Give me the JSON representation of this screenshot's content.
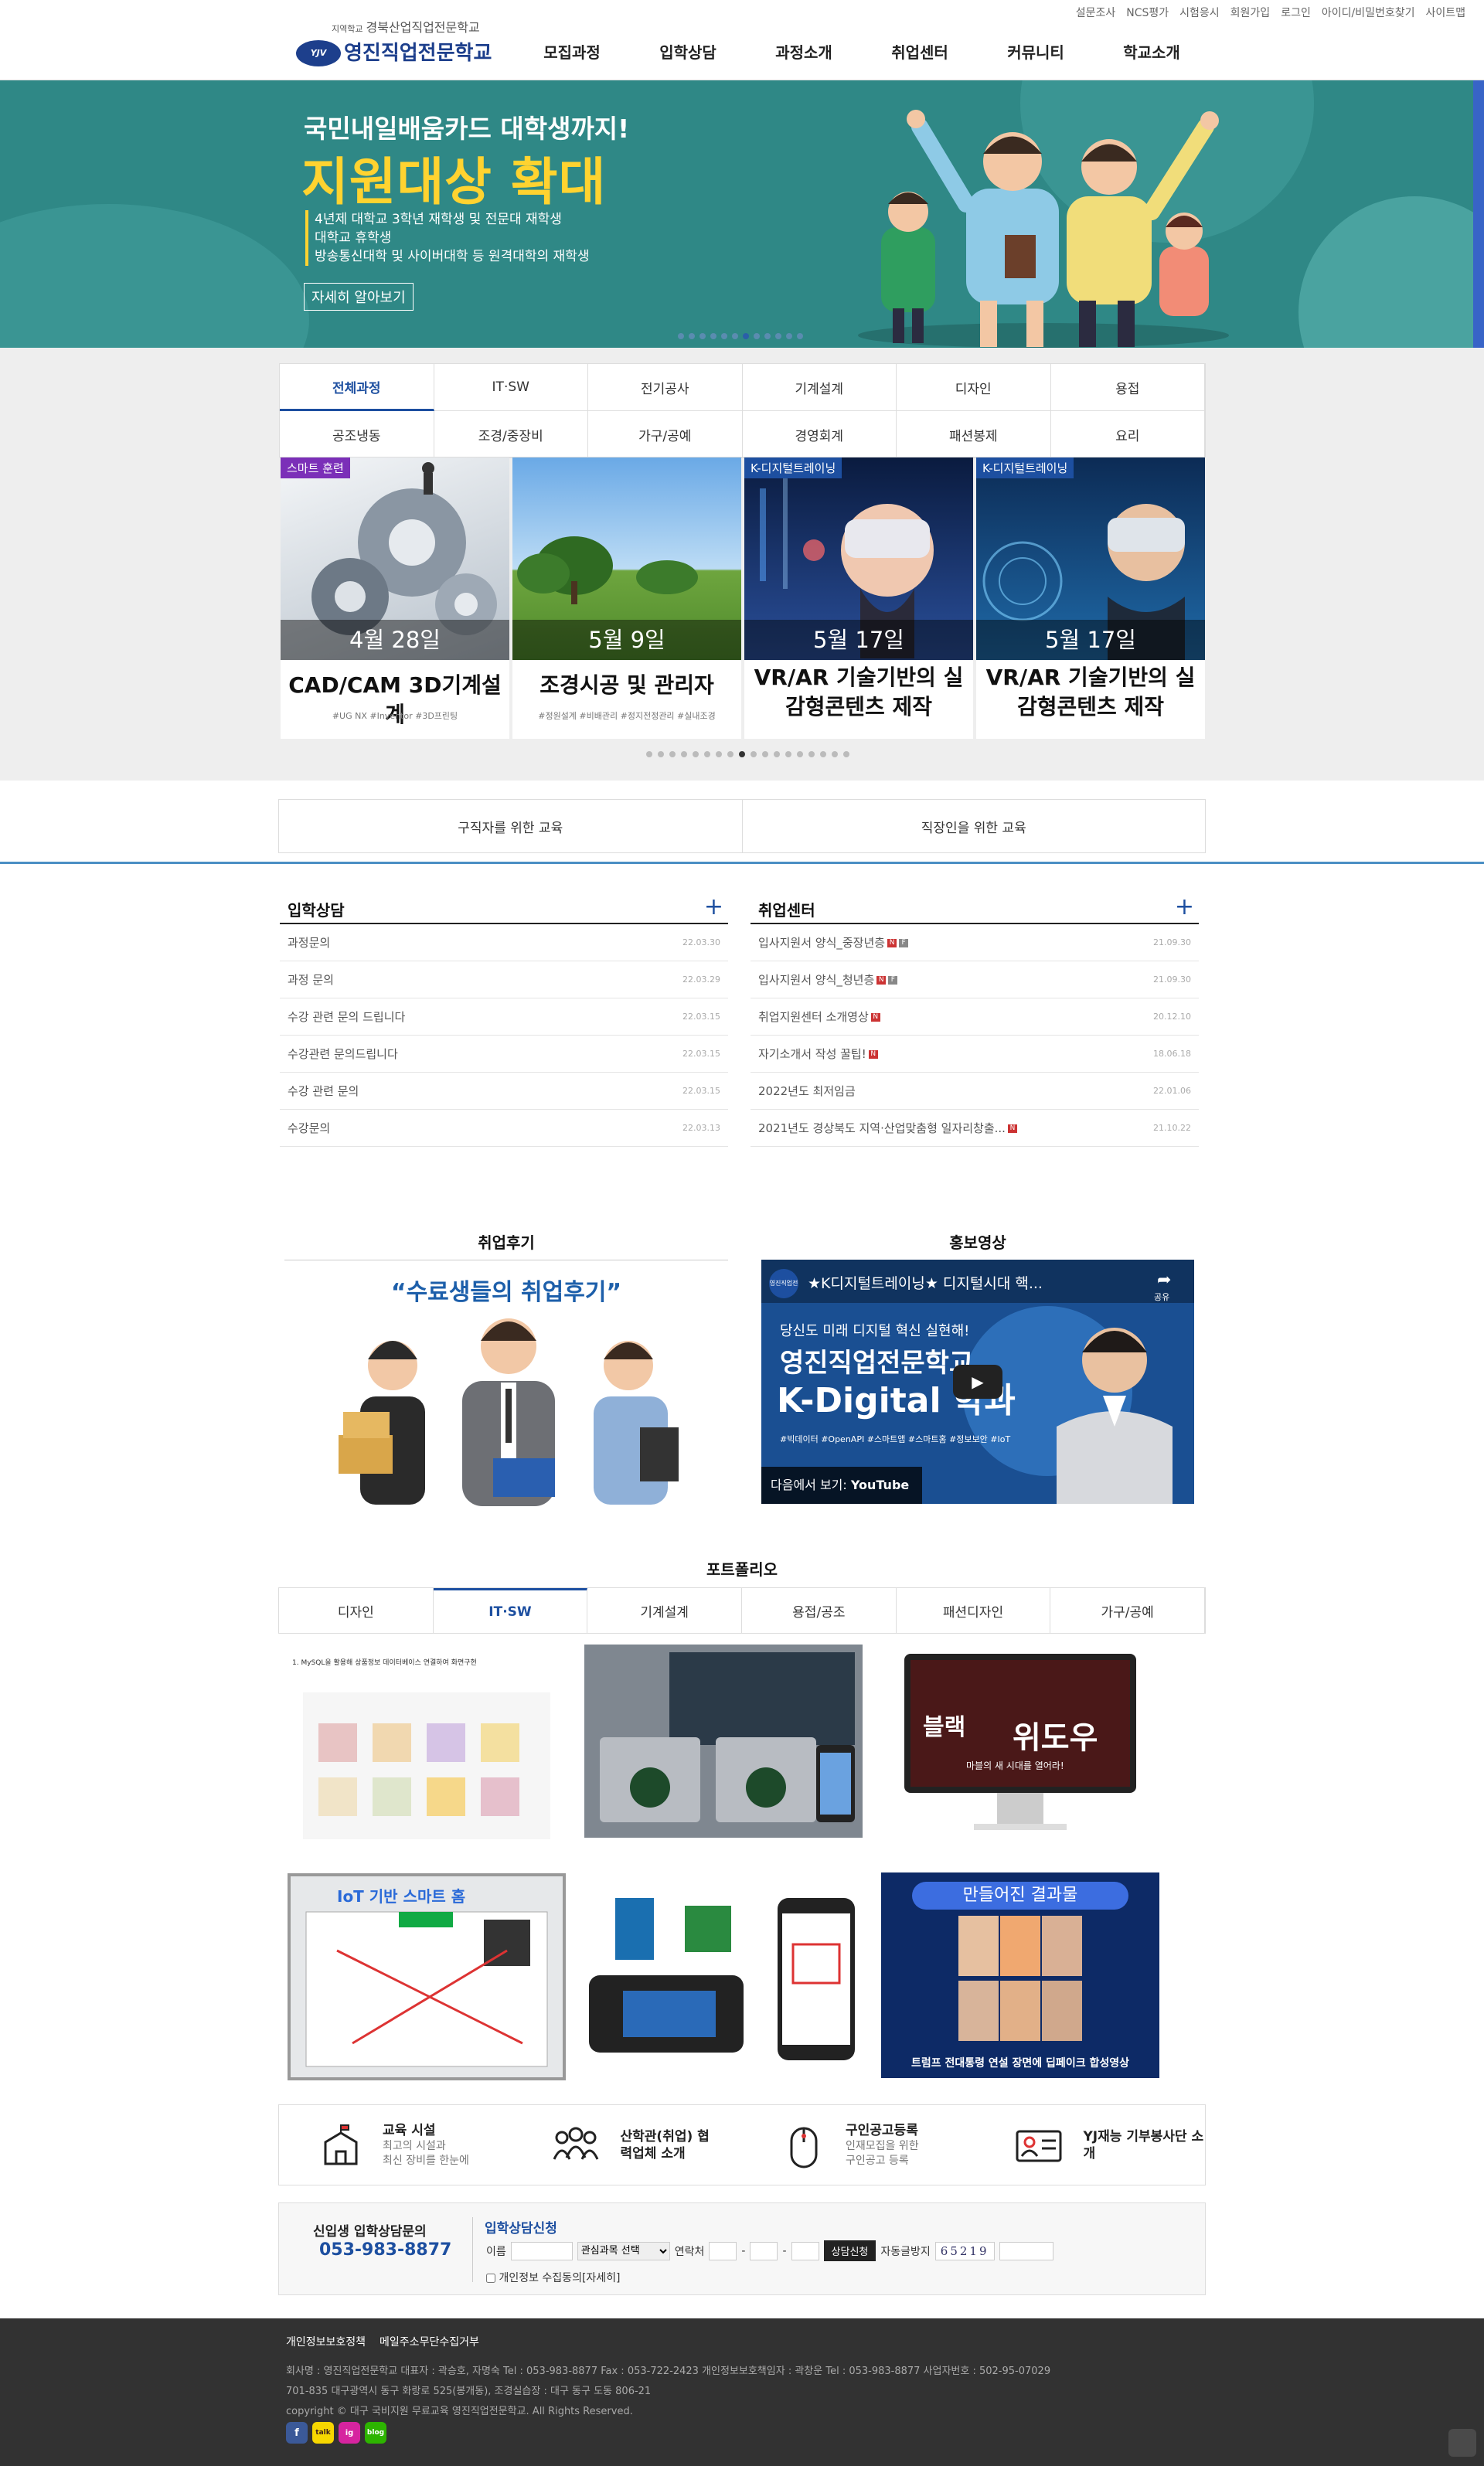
{
  "util_links": [
    "설문조사",
    "NCS평가",
    "시험응시",
    "회원가입",
    "로그인",
    "아이디/비밀번호찾기",
    "사이트맵"
  ],
  "logo": {
    "emblem": "YJV",
    "prefix": "지역학교",
    "sub": "경북산업직업전문학교",
    "name": "영진직업전문학교"
  },
  "gnb": [
    "모집과정",
    "입학상담",
    "과정소개",
    "취업센터",
    "커뮤니티",
    "학교소개"
  ],
  "banner": {
    "line1": "국민내일배움카드 대학생까지!",
    "headline": "지원대상 확대",
    "bullets": [
      "4년제 대학교 3학년 재학생 및 전문대 재학생",
      "대학교 휴학생",
      "방송통신대학 및 사이버대학 등 원격대학의 재학생"
    ],
    "button": "자세히 알아보기",
    "dots": 12,
    "active_dot": 6,
    "colors": {
      "bg": "#2f8886",
      "accent": "#ffd330"
    }
  },
  "course_tabs": [
    "전체과정",
    "IT·SW",
    "전기공사",
    "기계설계",
    "디자인",
    "용접",
    "공조냉동",
    "조경/중장비",
    "가구/공예",
    "경영회계",
    "패션봉제",
    "요리"
  ],
  "active_course_tab": "전체과정",
  "course_cards": [
    {
      "badge": "스마트 훈련",
      "date": "4월 28일",
      "title": "CAD/CAM 3D기계설계",
      "tags": "#UG NX #Inventor #3D프린팅"
    },
    {
      "badge": "",
      "date": "5월 9일",
      "title": "조경시공 및 관리자",
      "tags": "#정원설계 #비배관리 #정지전정관리 #실내조경"
    },
    {
      "badge": "K-디지털트레이닝",
      "date": "5월 17일",
      "title": "VR/AR 기술기반의 실감형콘텐츠 제작",
      "tags": ""
    },
    {
      "badge": "K-디지털트레이닝",
      "date": "5월 17일",
      "title": "VR/AR 기술기반의 실감형콘텐츠 제작",
      "tags": ""
    }
  ],
  "card_dots": 18,
  "card_active_dot": 8,
  "edu_targets": [
    "구직자를 위한 교육",
    "직장인을 위한 교육"
  ],
  "admission_board": {
    "title": "입학상담",
    "plus": "+",
    "rows": [
      {
        "t": "과정문의",
        "d": "22.03.30"
      },
      {
        "t": "과정 문의",
        "d": "22.03.29"
      },
      {
        "t": "수강 관련 문의 드립니다",
        "d": "22.03.15"
      },
      {
        "t": "수강관련 문의드립니다",
        "d": "22.03.15"
      },
      {
        "t": "수강 관련 문의",
        "d": "22.03.15"
      },
      {
        "t": "수강문의",
        "d": "22.03.13"
      }
    ]
  },
  "job_board": {
    "title": "취업센터",
    "plus": "+",
    "rows": [
      {
        "t": "입사지원서 양식_중장년층",
        "d": "21.09.30",
        "icons": [
          "N",
          "F"
        ]
      },
      {
        "t": "입사지원서 양식_청년층",
        "d": "21.09.30",
        "icons": [
          "N",
          "F"
        ]
      },
      {
        "t": "취업지원센터 소개영상",
        "d": "20.12.10",
        "icons": [
          "N"
        ]
      },
      {
        "t": "자기소개서 작성 꿀팁!",
        "d": "18.06.18",
        "icons": [
          "N"
        ]
      },
      {
        "t": "2022년도 최저임금",
        "d": "22.01.06",
        "icons": []
      },
      {
        "t": "2021년도 경상북도 지역·산업맞춤형 일자리창출...",
        "d": "21.10.22",
        "icons": [
          "N"
        ]
      }
    ]
  },
  "review": {
    "title": "취업후기",
    "quote": "“수료생들의 취업후기”"
  },
  "promo": {
    "title": "홍보영상",
    "video_title": "★K디지털트레이닝★ 디지털시대 핵...",
    "share": "공유",
    "line1": "당신도 미래 디지털 혁신 실현해!",
    "line2": "영진직업전문학교",
    "line3": "K-Digital 학과",
    "tags": "#빅데이터 #OpenAPI #스마트앱 #스마트홈 #정보보안 #IoT",
    "watch_on": "다음에서 보기:",
    "yt": "YouTube",
    "badge": "영진직업전문학교"
  },
  "portfolio": {
    "title": "포트폴리오",
    "tabs": [
      "디자인",
      "IT·SW",
      "기계설계",
      "용접/공조",
      "패션디자인",
      "가구/공예"
    ],
    "active_tab": "IT·SW",
    "p1_caption": "1. MySQL을 활용해 상품정보 데이터베이스 연결하여 화면구현",
    "p4_title": "IoT 기반 스마트 홈",
    "p8_title": "만들어진 결과물",
    "p8_caption": "트럼프 전대통령 연설 장면에 딥페이크 합성영상",
    "p3_title1": "블랙",
    "p3_title2": "위도우",
    "p3_sub": "마블의 새 시대를 열어라!"
  },
  "quick_links": [
    {
      "icon": "school-icon",
      "title": "교육 시설",
      "sub": [
        "최고의 시설과",
        "최신 장비를 한눈에"
      ]
    },
    {
      "icon": "people-icon",
      "title": "산학관(취업) 협력업체 소개",
      "sub": []
    },
    {
      "icon": "mouse-icon",
      "title": "구인공고등록",
      "sub": [
        "인재모집을 위한",
        "구인공고 등록"
      ]
    },
    {
      "icon": "id-card-icon",
      "title": "YJ재능 기부봉사단 소개",
      "sub": []
    }
  ],
  "consult": {
    "left_title": "신입생 입학상담문의",
    "phone": "053-983-8877",
    "form_title": "입학상담신청",
    "name_label": "이름",
    "select_value": "관심과목 선택",
    "contact_label": "연락처",
    "submit": "상담신청",
    "captcha_label": "자동글방지",
    "captcha": "65219",
    "agree": "개인정보 수집동의[자세히]"
  },
  "footer": {
    "links": [
      "개인정보보호정책",
      "메일주소무단수집거부"
    ],
    "line1": "회사명 : 영진직업전문학교   대표자 : 곽승호, 자명숙   Tel : 053-983-8877   Fax : 053-722-2423   개인정보보호책임자 : 곽창운   Tel : 053-983-8877   사업자번호 : 502-95-07029",
    "line2": "701-835 대구광역시 동구 화랑로 525(봉개동), 조경실습장 : 대구 동구 도동 806-21",
    "line3": "copyright © 대구 국비지원 무료교육 영진직업전문학교. All Rights Reserved.",
    "sns": [
      "f",
      "talk",
      "ig",
      "blog"
    ]
  }
}
